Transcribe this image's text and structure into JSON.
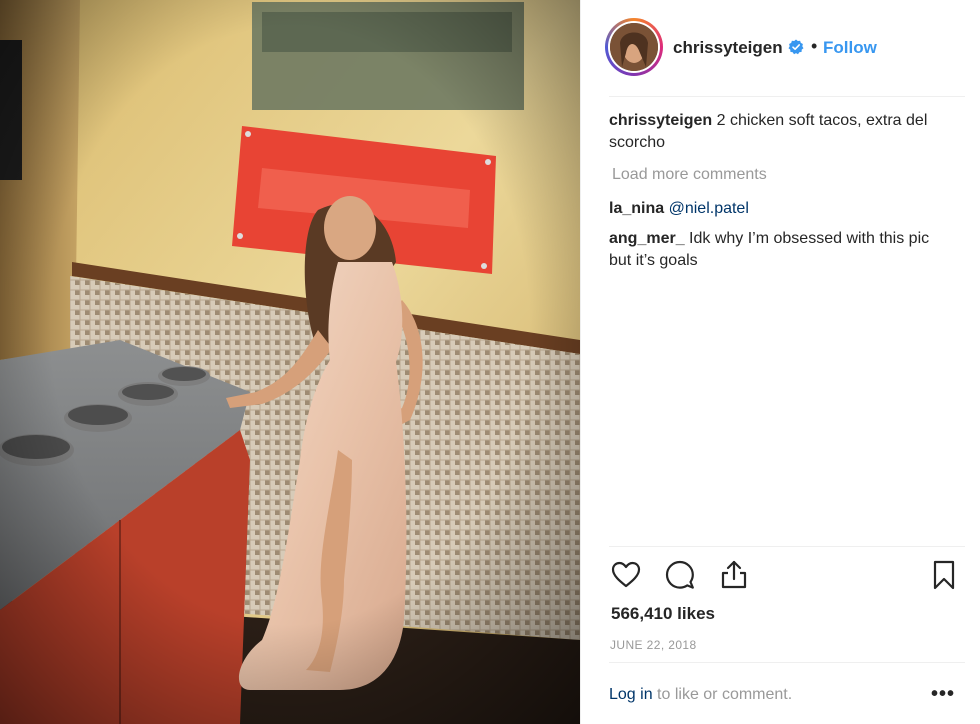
{
  "post": {
    "username": "chrissyteigen",
    "follow_label": "Follow",
    "separator": "•",
    "caption": {
      "user": "chrissyteigen",
      "text": " 2 chicken soft tacos, extra del scorcho"
    },
    "load_more": "Load more comments",
    "comments": [
      {
        "user": "la_nina",
        "text": "@niel.patel"
      },
      {
        "user": "ang_mer_",
        "text": " Idk why I’m obsessed with this pic but it’s goals"
      }
    ],
    "likes": "566,410 likes",
    "date": "JUNE 22, 2018",
    "login_link": "Log in",
    "login_suffix": " to like or comment.",
    "more_label": "•••"
  },
  "icons": {
    "like": "heart-icon",
    "comment": "comment-icon",
    "share": "share-icon",
    "save": "bookmark-icon",
    "verified": "verified-badge-icon"
  },
  "colors": {
    "accent": "#3897f0",
    "link": "#003569",
    "muted": "#999999",
    "text": "#262626"
  }
}
